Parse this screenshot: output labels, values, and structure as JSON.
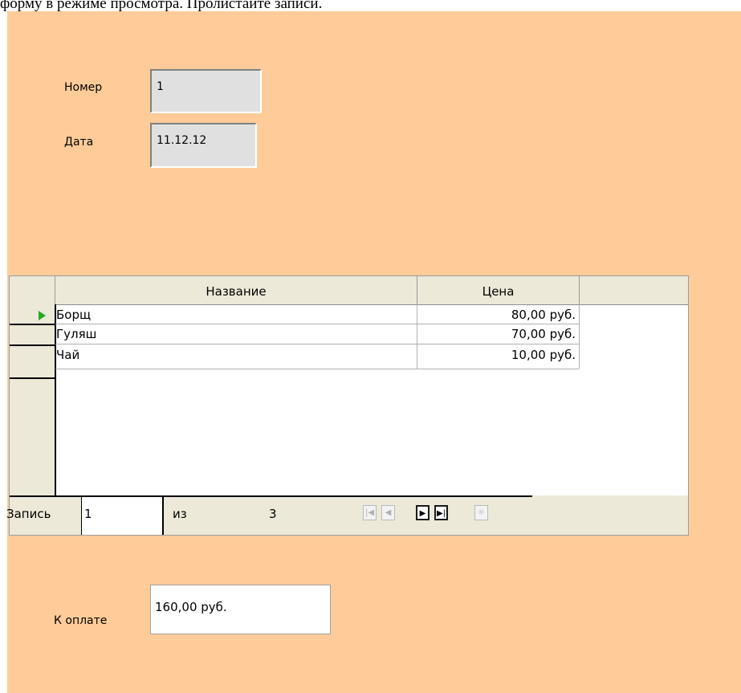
{
  "instruction": "форму в режиме просмотра. Пролистайте записи.",
  "form": {
    "number_label": "Номер",
    "number_value": "1",
    "date_label": "Дата",
    "date_value": "11.12.12",
    "total_label": "К оплате",
    "total_value": "160,00 руб."
  },
  "grid": {
    "columns": [
      "Название",
      "Цена"
    ],
    "rows": [
      {
        "name": "Борщ",
        "price": "80,00 руб."
      },
      {
        "name": "Гуляш",
        "price": "70,00 руб."
      },
      {
        "name": "Чай",
        "price": "10,00 руб."
      }
    ]
  },
  "navigator": {
    "record_label": "Запись",
    "record_value": "1",
    "of_label": "из",
    "total_records": "3",
    "buttons": [
      "first-record",
      "previous-record",
      "next-record",
      "last-record",
      "new-record"
    ]
  },
  "colors": {
    "form_background": "#ffcc99",
    "grid_header": "#ece9d8",
    "current_row_marker": "#22aa22"
  }
}
